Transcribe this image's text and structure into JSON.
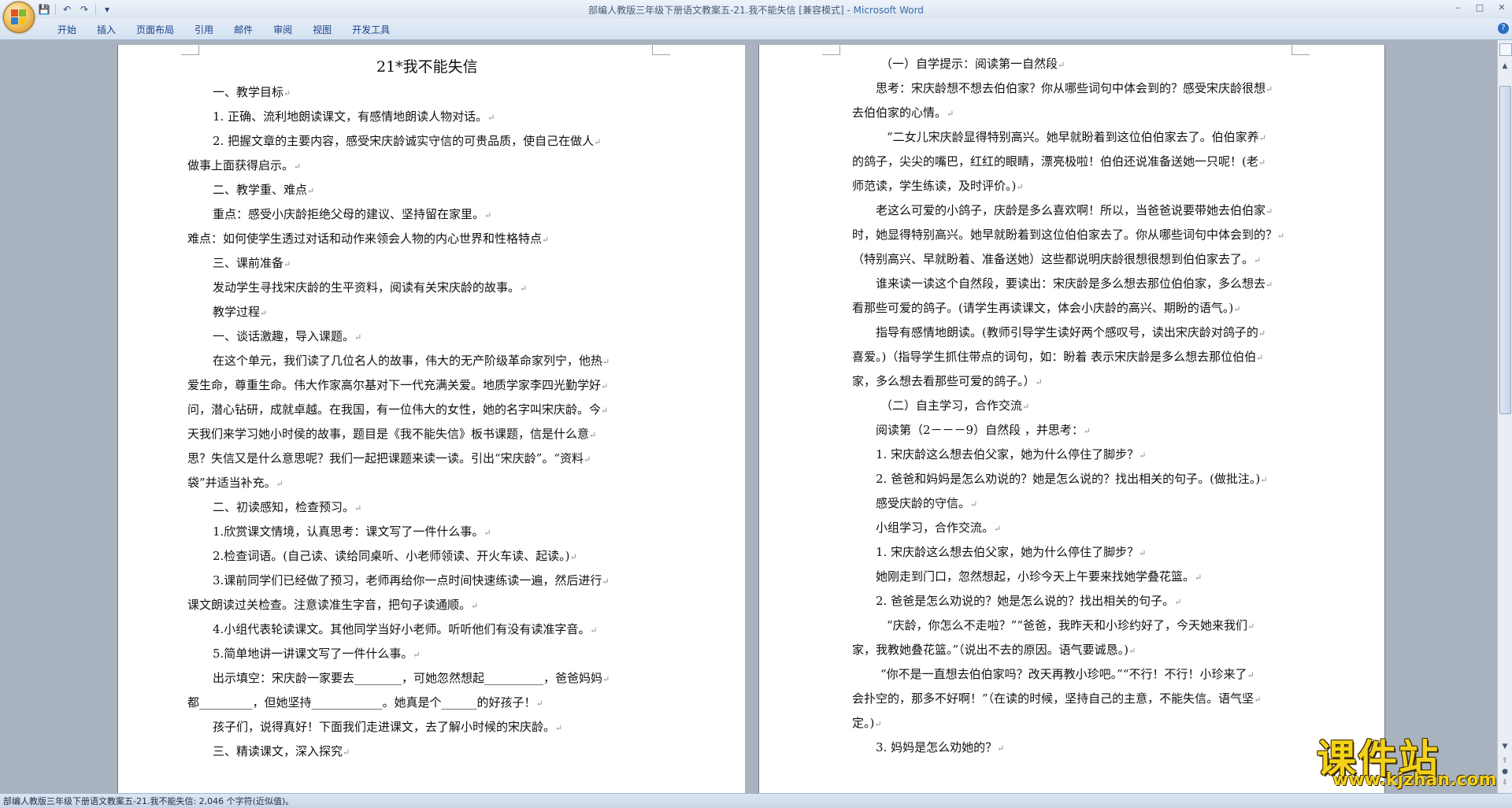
{
  "window": {
    "title": "部编人教版三年级下册语文教案五-21.我不能失信 [兼容模式] - ",
    "app_name": "Microsoft Word"
  },
  "ribbon": {
    "tabs": [
      "开始",
      "插入",
      "页面布局",
      "引用",
      "邮件",
      "审阅",
      "视图",
      "开发工具"
    ]
  },
  "qat_icons": [
    "save-icon",
    "undo-icon",
    "redo-icon",
    "customize-icon"
  ],
  "document": {
    "title": "21*我不能失信",
    "left_page_lines": [
      "一、教学目标",
      "1. 正确、流利地朗读课文，有感情地朗读人物对话。",
      "2. 把握文章的主要内容，感受宋庆龄诚实守信的可贵品质，使自己在做人",
      "做事上面获得启示。",
      "二、教学重、难点",
      "重点：感受小庆龄拒绝父母的建议、坚持留在家里。",
      "难点：如何使学生透过对话和动作来领会人物的内心世界和性格特点",
      "三、课前准备",
      "发动学生寻找宋庆龄的生平资料，阅读有关宋庆龄的故事。",
      "教学过程",
      "一、谈话激趣，导入课题。",
      "在这个单元，我们读了几位名人的故事，伟大的无产阶级革命家列宁，他热",
      "爱生命，尊重生命。伟大作家高尔基对下一代充满关爱。地质学家李四光勤学好",
      "问，潜心钻研，成就卓越。在我国，有一位伟大的女性，她的名字叫宋庆龄。今",
      "天我们来学习她小时侯的故事，题目是《我不能失信》板书课题，信是什么意",
      "思？失信又是什么意思呢？我们一起把课题来读一读。引出“宋庆龄”。“资料",
      "袋”并适当补充。",
      "二、初读感知，检查预习。",
      "1.欣赏课文情境，认真思考：课文写了一件什么事。",
      "2.检查词语。(自己读、读给同桌听、小老师领读、开火车读、起读。)",
      "3.课前同学们已经做了预习，老师再给你一点时间快速练读一遍，然后进行",
      "课文朗读过关检查。注意读准生字音，把句子读通顺。",
      "4.小组代表轮读课文。其他同学当好小老师。听听他们有没有读准字音。",
      "5.简单地讲一讲课文写了一件什么事。",
      "出示填空：宋庆龄一家要去________，可她忽然想起__________，爸爸妈妈",
      "都_________，但她坚持____________。她真是个______的好孩子！",
      "孩子们，说得真好！下面我们走进课文，去了解小时候的宋庆龄。",
      "三、精读课文，深入探究"
    ],
    "right_page_lines": [
      "（一）自学提示：阅读第一自然段",
      "思考：宋庆龄想不想去伯伯家？你从哪些词句中体会到的？感受宋庆龄很想",
      "去伯伯家的心情。",
      "“二女儿宋庆龄显得特别高兴。她早就盼着到这位伯伯家去了。伯伯家养",
      "的鸽子，尖尖的嘴巴，红红的眼睛，漂亮极啦！伯伯还说准备送她一只呢！(老",
      "师范读，学生练读，及时评价。)",
      "老这么可爱的小鸽子，庆龄是多么喜欢啊！所以，当爸爸说要带她去伯伯家",
      "时，她显得特别高兴。她早就盼着到这位伯伯家去了。你从哪些词句中体会到的？",
      "（特别高兴、早就盼着、准备送她）这些都说明庆龄很想很想到伯伯家去了。",
      "谁来读一读这个自然段，要读出：宋庆龄是多么想去那位伯伯家，多么想去",
      "看那些可爱的鸽子。(请学生再读课文，体会小庆龄的高兴、期盼的语气。)",
      "指导有感情地朗读。(教师引导学生读好两个感叹号，读出宋庆龄对鸽子的",
      "喜爱。)（指导学生抓住带点的词句，如：盼着   表示宋庆龄是多么想去那位伯伯",
      "家，多么想去看那些可爱的鸽子。）",
      "（二）自主学习，合作交流",
      "阅读第（2－－－9）自然段 ，并思考：",
      "1. 宋庆龄这么想去伯父家，她为什么停住了脚步？",
      "2. 爸爸和妈妈是怎么劝说的？她是怎么说的？找出相关的句子。(做批注。)",
      "感受庆龄的守信。",
      "小组学习，合作交流。",
      "1. 宋庆龄这么想去伯父家，她为什么停住了脚步？",
      "她刚走到门口，忽然想起，小珍今天上午要来找她学叠花篮。",
      "2. 爸爸是怎么劝说的？她是怎么说的？找出相关的句子。",
      "“庆龄，你怎么不走啦？”“爸爸，我昨天和小珍约好了，今天她来我们",
      "家，我教她叠花篮。”（说出不去的原因。语气要诚恳。)",
      "“你不是一直想去伯伯家吗？改天再教小珍吧。”“不行！不行！小珍来了",
      "会扑空的，那多不好啊！”（在读的时候，坚持自己的主意，不能失信。语气坚",
      "定。)",
      "3. 妈妈是怎么劝她的？"
    ]
  },
  "status_bar": {
    "text": "部编人教版三年级下册语文教案五-21.我不能失信: 2,046 个字符(近似值)。"
  },
  "watermark": {
    "main": "课件站",
    "url": "www.kjzhan.com"
  },
  "colors": {
    "accent": "#15428b",
    "app_name": "#3b6ea8",
    "watermark": "#f4d21a"
  }
}
